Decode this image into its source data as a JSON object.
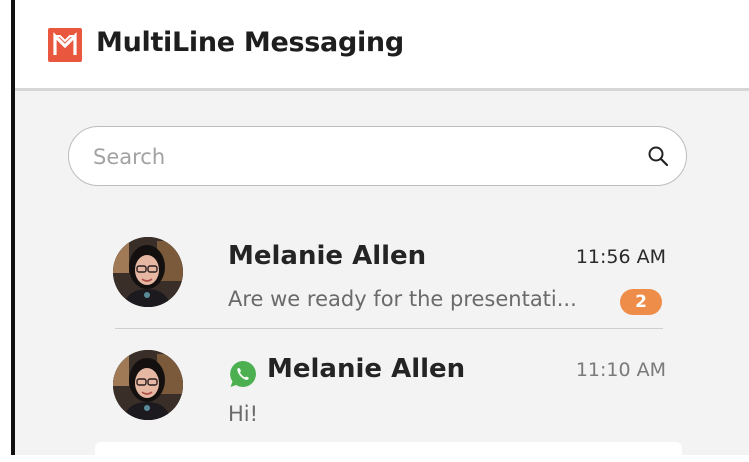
{
  "app": {
    "title": "MultiLine Messaging",
    "logo_icon": "multiline-m-logo",
    "brand_color": "#e9573f"
  },
  "search": {
    "placeholder": "Search",
    "value": "",
    "icon": "search-icon"
  },
  "conversations": [
    {
      "name": "Melanie Allen",
      "time": "11:56 AM",
      "preview": "Are we ready for the presentati...",
      "unread_count": "2",
      "channel_icon": null
    },
    {
      "name": "Melanie Allen",
      "time": "11:10 AM",
      "preview": "Hi!",
      "unread_count": null,
      "channel_icon": "whatsapp-icon"
    }
  ],
  "colors": {
    "badge": "#ee8c49",
    "whatsapp": "#4caf50",
    "panel_bg": "#f3f3f3"
  }
}
